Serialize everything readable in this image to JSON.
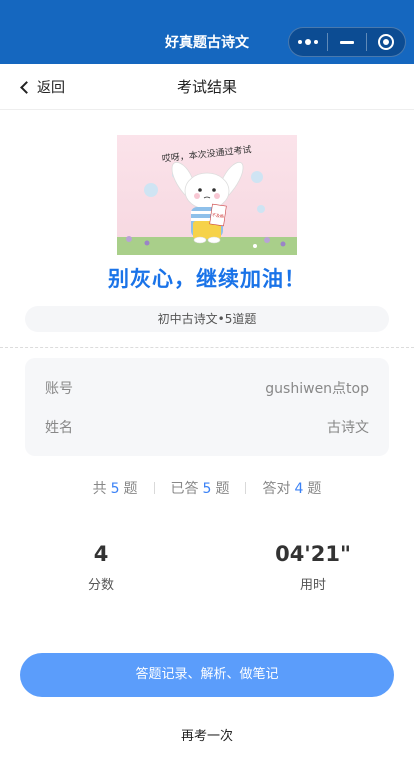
{
  "app": {
    "title": "好真题古诗文"
  },
  "nav": {
    "back_label": "返回",
    "title": "考试结果"
  },
  "illustration": {
    "caption": "哎呀，本次没通过考试",
    "paper_text": "不及格"
  },
  "result": {
    "headline": "别灰心，继续加油！",
    "exam_tag": "初中古诗文•5道题"
  },
  "account": {
    "rows": [
      {
        "label": "账号",
        "value": "gushiwen点top"
      },
      {
        "label": "姓名",
        "value": "古诗文"
      }
    ]
  },
  "stats": {
    "total_prefix": "共",
    "total_value": "5",
    "total_suffix": "题",
    "answered_prefix": "已答",
    "answered_value": "5",
    "answered_suffix": "题",
    "correct_prefix": "答对",
    "correct_value": "4",
    "correct_suffix": "题"
  },
  "score": {
    "value": "4",
    "label": "分数"
  },
  "time": {
    "value": "04'21\"",
    "label": "用时"
  },
  "actions": {
    "records_label": "答题记录、解析、做笔记",
    "retry_label": "再考一次"
  },
  "colors": {
    "topbar": "#1567bf",
    "accent": "#1a73e8",
    "button": "#5b9dfb",
    "stat_number": "#3b82f6"
  },
  "icons": [
    "more-dots-icon",
    "minimize-icon",
    "target-icon",
    "chevron-left-icon"
  ]
}
